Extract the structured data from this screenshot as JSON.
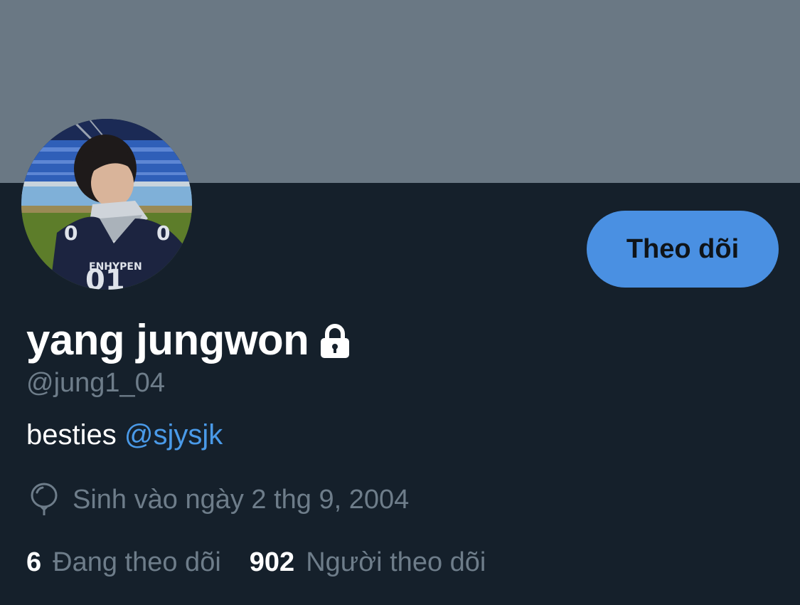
{
  "profile": {
    "display_name": "yang jungwon",
    "handle": "@jung1_04",
    "bio_text": "besties",
    "bio_mention": "@sjysjk",
    "birthday": "Sinh vào ngày 2 thg 9, 2004",
    "protected_icon": "lock-icon",
    "birthday_icon": "balloon-icon"
  },
  "actions": {
    "follow_label": "Theo dõi"
  },
  "stats": {
    "following_count": "6",
    "following_label": "Đang theo dõi",
    "followers_count": "902",
    "followers_label": "Người theo dõi"
  },
  "colors": {
    "background": "#15202b",
    "banner": "#6a7884",
    "accent": "#4a90e2",
    "link": "#4a9ae8",
    "secondary_text": "#6e7d8a",
    "primary_text": "#ffffff"
  }
}
